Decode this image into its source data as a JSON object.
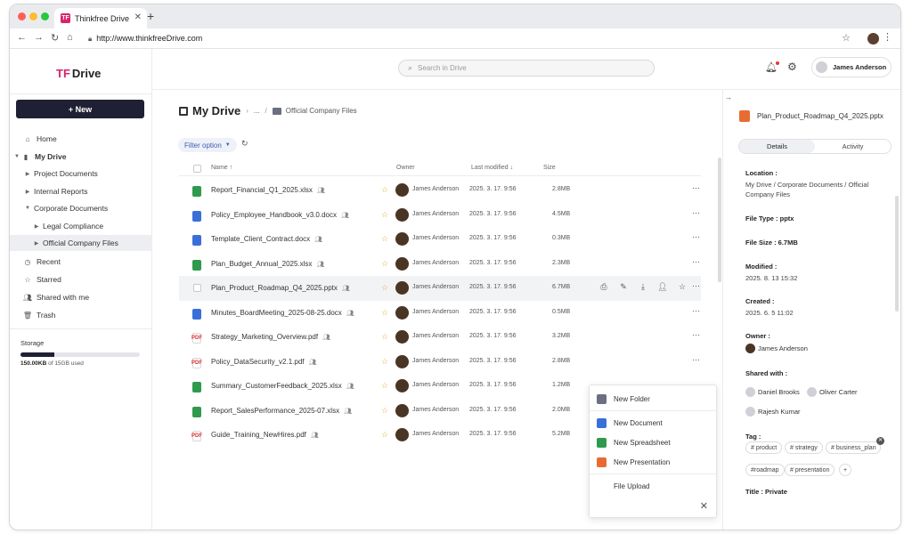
{
  "browser": {
    "tab_title": "Thinkfree Drive",
    "tab_icon_letter": "TF",
    "url": "http://www.thinkfreeDrive.com"
  },
  "sidebar": {
    "logo": "Drive",
    "new_label": "+ New",
    "items": [
      {
        "label": "Home",
        "icon": "home-icon"
      },
      {
        "label": "My Drive",
        "icon": "drive-icon"
      },
      {
        "label": "Project Documents"
      },
      {
        "label": "Internal Reports"
      },
      {
        "label": "Corporate Documents"
      },
      {
        "label": "Legal Compliance"
      },
      {
        "label": "Official Company Files"
      },
      {
        "label": "Recent",
        "icon": "clock-icon"
      },
      {
        "label": "Starred",
        "icon": "star-icon"
      },
      {
        "label": "Shared with me",
        "icon": "people-icon"
      },
      {
        "label": "Trash",
        "icon": "trash-icon"
      }
    ],
    "storage": {
      "label": "Storage",
      "used": "150.00KB",
      "of_text": "of 15GB used",
      "fill_fraction": 0.28
    }
  },
  "header": {
    "search_placeholder": "Search in Drive",
    "user": "James Anderson"
  },
  "main": {
    "breadcrumb_title": "My Drive",
    "breadcrumb_ellipsis": "...",
    "breadcrumb_current": "Official Company Files",
    "filter_label": "Filter option",
    "columns": {
      "name": "Name ↑",
      "owner": "Owner",
      "modified": "Last modified ↓",
      "size": "Size"
    },
    "files": [
      {
        "name": "Report_Financial_Q1_2025.xlsx",
        "type": "xls",
        "owner": "James Anderson",
        "modified": "2025. 3. 17. 9:56",
        "size": "2.8MB"
      },
      {
        "name": "Policy_Employee_Handbook_v3.0.docx",
        "type": "doc",
        "owner": "James Anderson",
        "modified": "2025. 3. 17. 9:56",
        "size": "4.5MB"
      },
      {
        "name": "Template_Client_Contract.docx",
        "type": "doc",
        "owner": "James Anderson",
        "modified": "2025. 3. 17. 9:56",
        "size": "0.3MB"
      },
      {
        "name": "Plan_Budget_Annual_2025.xlsx",
        "type": "xls",
        "owner": "James Anderson",
        "modified": "2025. 3. 17. 9:56",
        "size": "2.3MB"
      },
      {
        "name": "Plan_Product_Roadmap_Q4_2025.pptx",
        "type": "ppt",
        "owner": "James Anderson",
        "modified": "2025. 3. 17. 9:56",
        "size": "6.7MB"
      },
      {
        "name": "Minutes_BoardMeeting_2025-08-25.docx",
        "type": "doc",
        "owner": "James Anderson",
        "modified": "2025. 3. 17. 9:56",
        "size": "0.5MB"
      },
      {
        "name": "Strategy_Marketing_Overview.pdf",
        "type": "pdf",
        "owner": "James Anderson",
        "modified": "2025. 3. 17. 9:56",
        "size": "3.2MB"
      },
      {
        "name": "Policy_DataSecurity_v2.1.pdf",
        "type": "pdf",
        "owner": "James Anderson",
        "modified": "2025. 3. 17. 9:56",
        "size": "2.8MB"
      },
      {
        "name": "Summary_CustomerFeedback_2025.xlsx",
        "type": "xls",
        "owner": "James Anderson",
        "modified": "2025. 3. 17. 9:56",
        "size": "1.2MB"
      },
      {
        "name": "Report_SalesPerformance_2025-07.xlsx",
        "type": "xls",
        "owner": "James Anderson",
        "modified": "2025. 3. 17. 9:56",
        "size": "2.0MB"
      },
      {
        "name": "Guide_Training_NewHires.pdf",
        "type": "pdf",
        "owner": "James Anderson",
        "modified": "2025. 3. 17. 9:56",
        "size": "5.2MB"
      }
    ]
  },
  "popup": {
    "new_folder": "New Folder",
    "new_document": "New Document",
    "new_spreadsheet": "New Spreadsheet",
    "new_presentation": "New Presentation",
    "file_upload": "File Upload"
  },
  "details": {
    "file_name": "Plan_Product_Roadmap_Q4_2025.pptx",
    "tab_details": "Details",
    "tab_activity": "Activity",
    "location_label": "Location :",
    "location_value": "My Drive / Corporate Documents / Official Company Files",
    "type_label": "File Type : pptx",
    "size_label": "File Size : 6.7MB",
    "modified_label": "Modified :",
    "modified_value": "2025. 8. 13 15:32",
    "created_label": "Created :",
    "created_value": "2025. 6. 5 11:02",
    "owner_label": "Owner :",
    "owner_value": "James Anderson",
    "shared_label": "Shared with :",
    "shared": [
      "Daniel Brooks",
      "Oliver Carter",
      "Rajesh Kumar"
    ],
    "tag_label": "Tag :",
    "tags": [
      "# product",
      "# strategy",
      "# business_plan",
      "#roadmap",
      "# presentation"
    ],
    "add_tag": "+",
    "title_label": "Title : Private"
  },
  "colors": {
    "accent": "#1f2033",
    "brand": "#d8246d",
    "xlsx": "#2f9a4d",
    "docx": "#3a6fd8",
    "pptx": "#e86c32",
    "star": "#e3b33a"
  }
}
